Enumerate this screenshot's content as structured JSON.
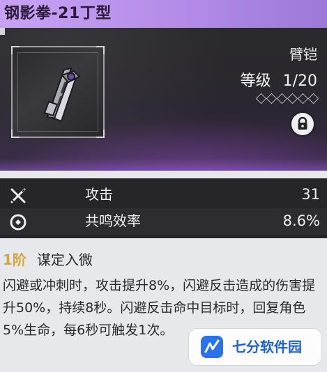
{
  "header": {
    "title": "钢影拳-21丁型"
  },
  "item": {
    "type": "臂铠",
    "level_label": "等级",
    "level_value": "1/20",
    "stars_total": 6,
    "stars_filled": 0,
    "locked": true
  },
  "stats": [
    {
      "icon": "attack-icon",
      "label": "攻击",
      "value": "31"
    },
    {
      "icon": "resonance-efficiency-icon",
      "label": "共鸣效率",
      "value": "8.6%"
    }
  ],
  "skill": {
    "rank": "1阶",
    "name": "谋定入微",
    "description": "闪避或冲刺时，攻击提升8%，闪避反击造成的伤害提升50%，持续8秒。闪避反击命中目标时，回复角色5%生命，每6秒可触发1次。"
  },
  "watermark": {
    "text": "七分软件园"
  },
  "colors": {
    "header_bg": "#b48ce8",
    "rank_color": "#d3a735",
    "card_bg": "#2b2630"
  }
}
